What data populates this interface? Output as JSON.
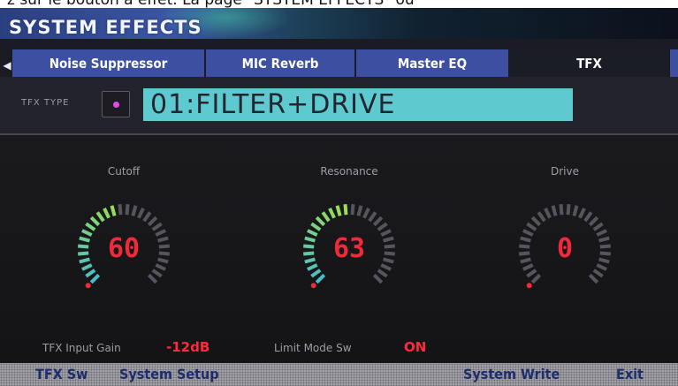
{
  "caption": "z sur le bouton à effet. La page \"SYSTEM EFFECTS\" ou",
  "header": {
    "title": "SYSTEM EFFECTS"
  },
  "tabs": [
    {
      "label": "Noise Suppressor"
    },
    {
      "label": "MIC Reverb"
    },
    {
      "label": "Master EQ"
    },
    {
      "label": "TFX",
      "selected": true
    }
  ],
  "tfx_type": {
    "label": "TFX TYPE",
    "value": "01:FILTER+DRIVE",
    "indicator_color": "#e04ce8"
  },
  "knobs": [
    {
      "label": "Cutoff",
      "value": "60",
      "level": 0.48
    },
    {
      "label": "Resonance",
      "value": "63",
      "level": 0.5
    },
    {
      "label": "Drive",
      "value": "0",
      "level": 0
    }
  ],
  "params": {
    "input_gain_label": "TFX Input Gain",
    "input_gain_value": "-12dB",
    "limit_mode_label": "Limit Mode Sw",
    "limit_mode_value": "ON"
  },
  "function_bar": {
    "tfx_sw": "TFX Sw",
    "system_setup": "System Setup",
    "system_write": "System Write",
    "exit": "Exit"
  },
  "colors": {
    "accent_red": "#f02a3a",
    "type_field": "#5ec9cf",
    "tab_blue": "#3d4fa0",
    "knob_inactive": "#55565d"
  }
}
